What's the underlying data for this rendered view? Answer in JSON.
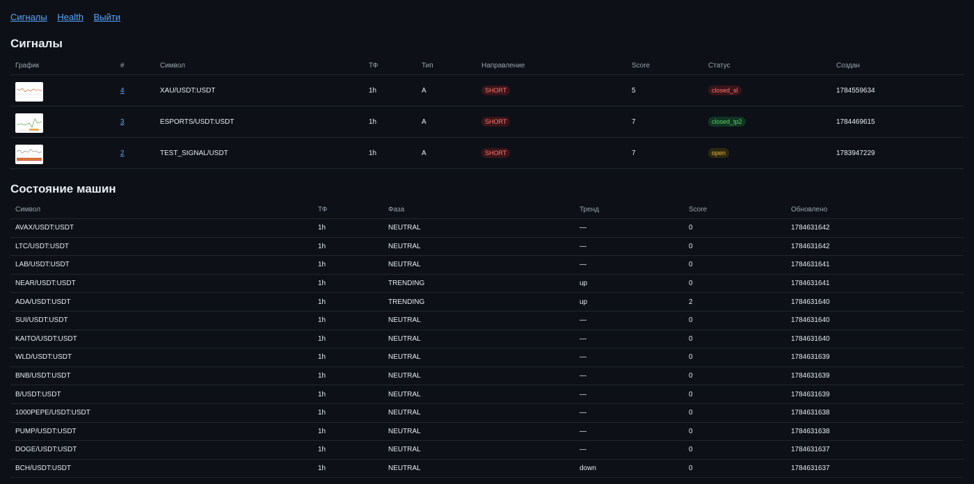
{
  "nav": {
    "signals": "Сигналы",
    "health": "Health",
    "logout": "Выйти"
  },
  "signals": {
    "title": "Сигналы",
    "headers": {
      "chart": "График",
      "id": "#",
      "symbol": "Символ",
      "tf": "ТФ",
      "type": "Тип",
      "direction": "Направление",
      "score": "Score",
      "status": "Статус",
      "created": "Создан"
    },
    "rows": [
      {
        "id": "4",
        "symbol": "XAU/USDT:USDT",
        "tf": "1h",
        "type": "A",
        "direction": "SHORT",
        "score": "5",
        "status": "closed_sl",
        "created": "1784559634"
      },
      {
        "id": "3",
        "symbol": "ESPORTS/USDT:USDT",
        "tf": "1h",
        "type": "A",
        "direction": "SHORT",
        "score": "7",
        "status": "closed_tp2",
        "created": "1784469615"
      },
      {
        "id": "2",
        "symbol": "TEST_SIGNAL/USDT",
        "tf": "1h",
        "type": "A",
        "direction": "SHORT",
        "score": "7",
        "status": "open",
        "created": "1783947229"
      }
    ]
  },
  "state": {
    "title": "Состояние машин",
    "headers": {
      "symbol": "Символ",
      "tf": "ТФ",
      "phase": "Фаза",
      "trend": "Тренд",
      "score": "Score",
      "updated": "Обновлено"
    },
    "rows": [
      {
        "symbol": "AVAX/USDT:USDT",
        "tf": "1h",
        "phase": "NEUTRAL",
        "trend": "—",
        "score": "0",
        "updated": "1784631642"
      },
      {
        "symbol": "LTC/USDT:USDT",
        "tf": "1h",
        "phase": "NEUTRAL",
        "trend": "—",
        "score": "0",
        "updated": "1784631642"
      },
      {
        "symbol": "LAB/USDT:USDT",
        "tf": "1h",
        "phase": "NEUTRAL",
        "trend": "—",
        "score": "0",
        "updated": "1784631641"
      },
      {
        "symbol": "NEAR/USDT:USDT",
        "tf": "1h",
        "phase": "TRENDING",
        "trend": "up",
        "score": "0",
        "updated": "1784631641"
      },
      {
        "symbol": "ADA/USDT:USDT",
        "tf": "1h",
        "phase": "TRENDING",
        "trend": "up",
        "score": "2",
        "updated": "1784631640"
      },
      {
        "symbol": "SUI/USDT:USDT",
        "tf": "1h",
        "phase": "NEUTRAL",
        "trend": "—",
        "score": "0",
        "updated": "1784631640"
      },
      {
        "symbol": "KAITO/USDT:USDT",
        "tf": "1h",
        "phase": "NEUTRAL",
        "trend": "—",
        "score": "0",
        "updated": "1784631640"
      },
      {
        "symbol": "WLD/USDT:USDT",
        "tf": "1h",
        "phase": "NEUTRAL",
        "trend": "—",
        "score": "0",
        "updated": "1784631639"
      },
      {
        "symbol": "BNB/USDT:USDT",
        "tf": "1h",
        "phase": "NEUTRAL",
        "trend": "—",
        "score": "0",
        "updated": "1784631639"
      },
      {
        "symbol": "B/USDT:USDT",
        "tf": "1h",
        "phase": "NEUTRAL",
        "trend": "—",
        "score": "0",
        "updated": "1784631639"
      },
      {
        "symbol": "1000PEPE/USDT:USDT",
        "tf": "1h",
        "phase": "NEUTRAL",
        "trend": "—",
        "score": "0",
        "updated": "1784631638"
      },
      {
        "symbol": "PUMP/USDT:USDT",
        "tf": "1h",
        "phase": "NEUTRAL",
        "trend": "—",
        "score": "0",
        "updated": "1784631638"
      },
      {
        "symbol": "DOGE/USDT:USDT",
        "tf": "1h",
        "phase": "NEUTRAL",
        "trend": "—",
        "score": "0",
        "updated": "1784631637"
      },
      {
        "symbol": "BCH/USDT:USDT",
        "tf": "1h",
        "phase": "NEUTRAL",
        "trend": "down",
        "score": "0",
        "updated": "1784631637"
      }
    ]
  },
  "colors": {
    "background": "#0d1117",
    "link": "#58a6ff",
    "badge_short": "#ff7b72",
    "badge_closed_sl": "#ff7b72",
    "badge_closed_tp2": "#56d364",
    "badge_open": "#e3b341"
  }
}
